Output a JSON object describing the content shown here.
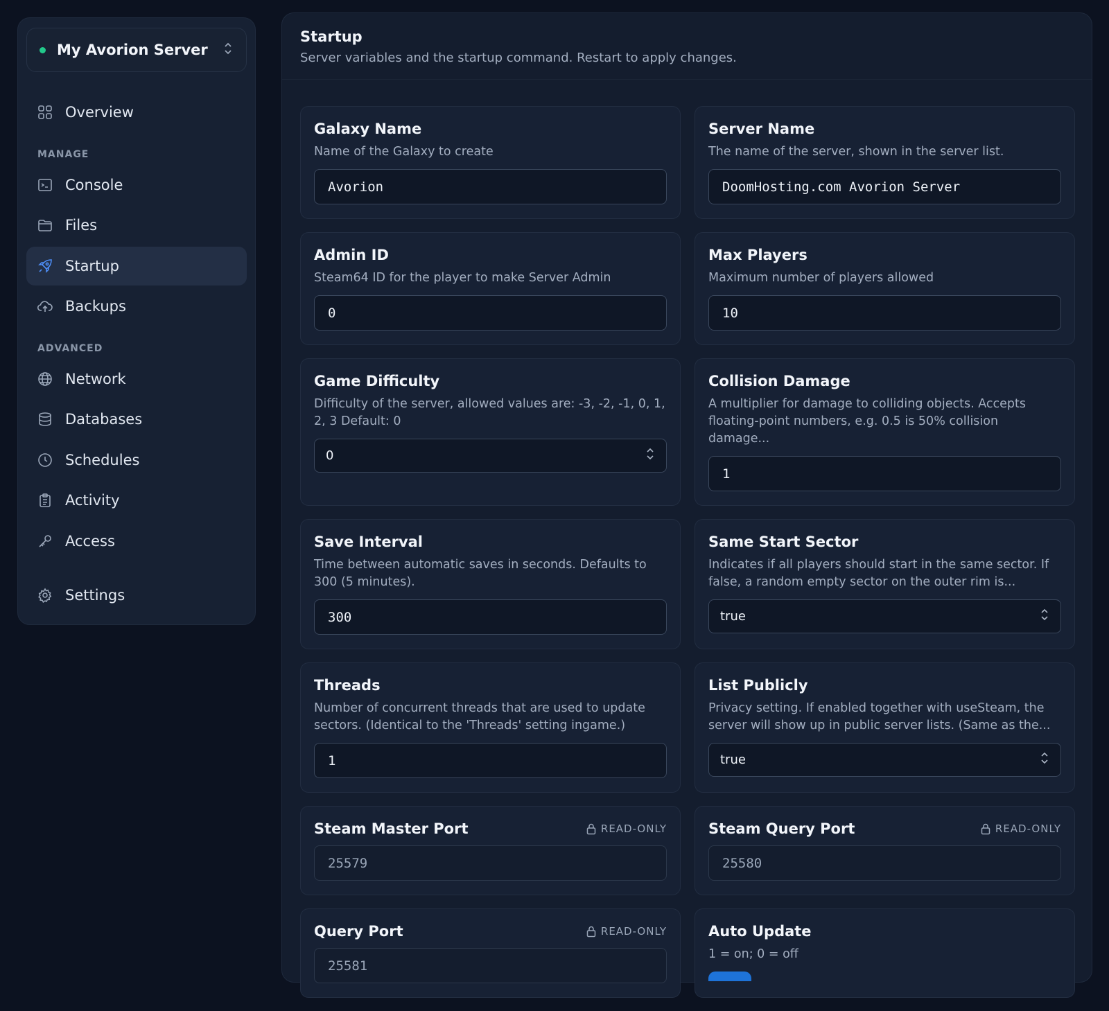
{
  "sidebar": {
    "server_name": "My Avorion Server",
    "status_color": "#22c98b",
    "overview": "Overview",
    "section_manage": "MANAGE",
    "console": "Console",
    "files": "Files",
    "startup": "Startup",
    "backups": "Backups",
    "section_advanced": "ADVANCED",
    "network": "Network",
    "databases": "Databases",
    "schedules": "Schedules",
    "activity": "Activity",
    "access": "Access",
    "settings": "Settings"
  },
  "main": {
    "title": "Startup",
    "subtitle": "Server variables and the startup command. Restart to apply changes."
  },
  "vars": {
    "galaxy_name": {
      "title": "Galaxy Name",
      "desc": "Name of the Galaxy to create",
      "value": "Avorion"
    },
    "server_name": {
      "title": "Server Name",
      "desc": "The name of the server, shown in the server list.",
      "value": "DoomHosting.com Avorion Server"
    },
    "admin_id": {
      "title": "Admin ID",
      "desc": "Steam64 ID for the player to make Server Admin",
      "value": "0"
    },
    "max_players": {
      "title": "Max Players",
      "desc": "Maximum number of players allowed",
      "value": "10"
    },
    "game_difficulty": {
      "title": "Game Difficulty",
      "desc": "Difficulty of the server, allowed values are: -3, -2, -1, 0, 1, 2, 3 Default: 0",
      "value": "0"
    },
    "collision_damage": {
      "title": "Collision Damage",
      "desc": "A multiplier for damage to colliding objects. Accepts floating-point numbers, e.g. 0.5 is 50% collision damage...",
      "value": "1"
    },
    "save_interval": {
      "title": "Save Interval",
      "desc": "Time between automatic saves in seconds. Defaults to 300 (5 minutes).",
      "value": "300"
    },
    "same_start_sector": {
      "title": "Same Start Sector",
      "desc": "Indicates if all players should start in the same sector. If false, a random empty sector on the outer rim is...",
      "value": "true"
    },
    "threads": {
      "title": "Threads",
      "desc": "Number of concurrent threads that are used to update sectors. (Identical to the 'Threads' setting ingame.)",
      "value": "1"
    },
    "list_publicly": {
      "title": "List Publicly",
      "desc": "Privacy setting. If enabled together with useSteam, the server will show up in public server lists. (Same as the...",
      "value": "true"
    },
    "steam_master_port": {
      "title": "Steam Master Port",
      "badge": "READ-ONLY",
      "value": "25579"
    },
    "steam_query_port": {
      "title": "Steam Query Port",
      "badge": "READ-ONLY",
      "value": "25580"
    },
    "query_port": {
      "title": "Query Port",
      "badge": "READ-ONLY",
      "value": "25581"
    },
    "auto_update": {
      "title": "Auto Update",
      "desc": "1 = on; 0 = off"
    }
  }
}
